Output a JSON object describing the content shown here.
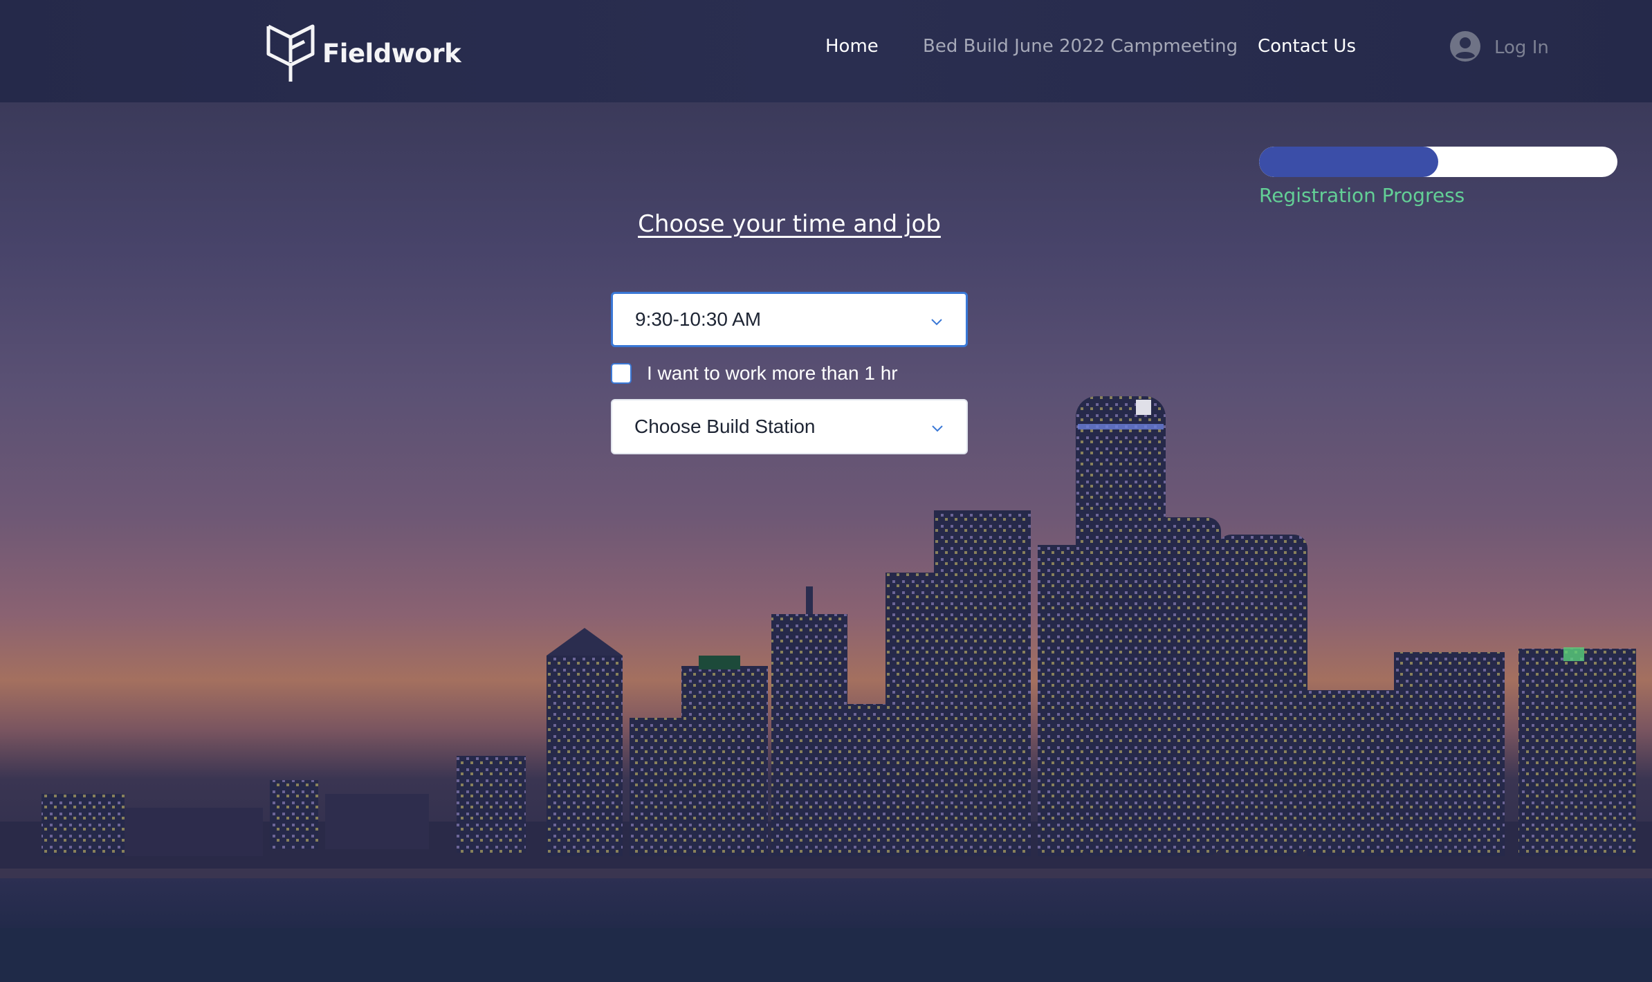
{
  "header": {
    "brand": "Fieldwork",
    "nav": [
      {
        "label": "Home"
      },
      {
        "label": "Bed Build June 2022 Campmeeting"
      },
      {
        "label": "Contact Us"
      }
    ],
    "login_label": "Log In"
  },
  "progress": {
    "label": "Registration Progress",
    "fraction": 0.5
  },
  "form": {
    "title": "Choose your time and job",
    "time_select": {
      "value": "9:30-10:30 AM"
    },
    "more_than_hour": {
      "label": "I want to work more than 1 hr",
      "checked": false
    },
    "station_select": {
      "value": "Choose Build Station"
    }
  },
  "colors": {
    "header_bg": "#25294a",
    "accent_blue": "#3b4ea8",
    "progress_label": "#63cf96",
    "focus_border": "#3a78d6"
  },
  "icons": [
    "fieldwork-logo-icon",
    "user-avatar-icon",
    "chevron-down-icon"
  ]
}
